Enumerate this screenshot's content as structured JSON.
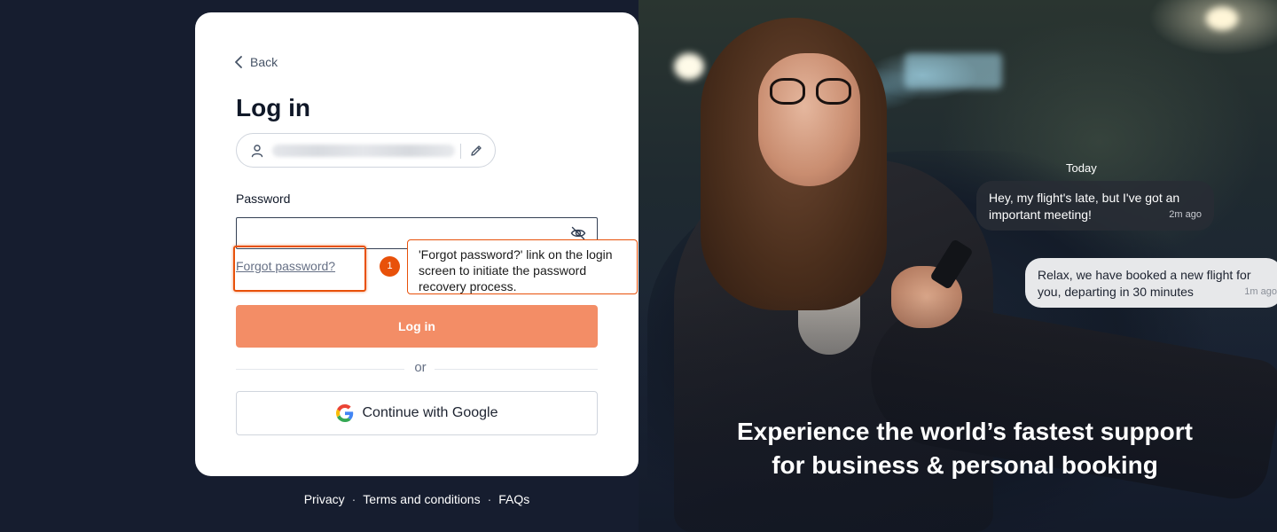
{
  "login": {
    "back_label": "Back",
    "title": "Log in",
    "password_label": "Password",
    "password_value": "",
    "forgot_label": "Forgot password?",
    "login_button": "Log in",
    "divider_text": "or",
    "google_button": "Continue with Google"
  },
  "annotation": {
    "number": "1",
    "text": "'Forgot password?' link on the login screen to initiate the password recovery process.",
    "color": "#e8510a"
  },
  "chat": {
    "day_label": "Today",
    "messages": [
      {
        "text": "Hey, my flight's late, but I've got an important meeting!",
        "time": "2m ago"
      },
      {
        "text": "Relax, we have booked a new flight for you, departing in 30 minutes",
        "time": "1m ago"
      }
    ]
  },
  "hero": {
    "tagline_line1": "Experience the world’s fastest support",
    "tagline_line2": "for business & personal booking"
  },
  "footer": {
    "links": [
      "Privacy",
      "Terms and conditions",
      "FAQs"
    ],
    "separator": "·"
  },
  "theme": {
    "accent": "#f38d66",
    "background": "#161d2f",
    "card": "#ffffff"
  },
  "icons": {
    "back": "chevron-left-icon",
    "user": "user-icon",
    "edit": "pencil-icon",
    "password_visibility": "eye-off-icon",
    "google": "google-icon"
  }
}
